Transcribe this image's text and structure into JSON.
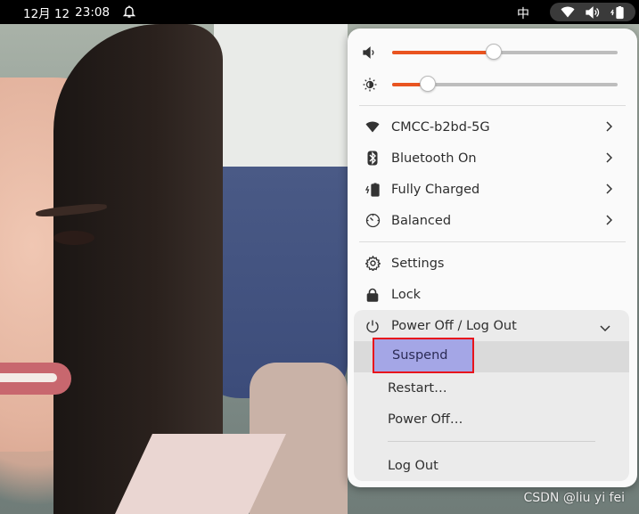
{
  "topbar": {
    "date": "12月 12",
    "time": "23:08",
    "input_method": "中",
    "icons": [
      "bell-icon",
      "wifi-icon",
      "volume-icon",
      "battery-icon"
    ]
  },
  "menu": {
    "volume_level": 0.45,
    "brightness_level": 0.16,
    "accent_color": "#e95420",
    "items": [
      {
        "label": "CMCC-b2bd-5G",
        "icon": "wifi-icon"
      },
      {
        "label": "Bluetooth On",
        "icon": "bluetooth-icon"
      },
      {
        "label": "Fully Charged",
        "icon": "battery-icon"
      },
      {
        "label": "Balanced",
        "icon": "power-mode-icon"
      }
    ],
    "settings_label": "Settings",
    "lock_label": "Lock",
    "power": {
      "label": "Power Off / Log Out",
      "suspend": "Suspend",
      "restart": "Restart…",
      "power_off": "Power Off…",
      "log_out": "Log Out"
    },
    "highlight_color": "#e8141c"
  },
  "watermark": "CSDN @liu  yi  fei"
}
